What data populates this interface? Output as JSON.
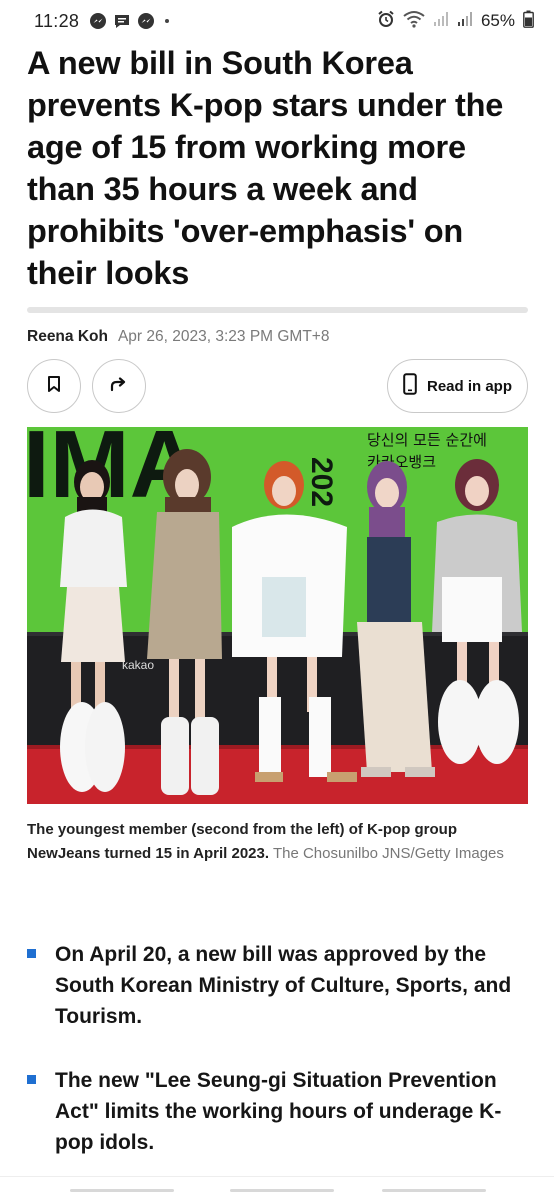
{
  "status_bar": {
    "time": "11:28",
    "battery": "65%",
    "notification_icons": [
      "messenger-icon",
      "chat-icon",
      "messenger-icon"
    ],
    "system_icons": [
      "alarm-icon",
      "wifi-icon",
      "signal-icon",
      "signal-icon",
      "battery-icon"
    ]
  },
  "article": {
    "headline": "A new bill in South Korea prevents K-pop stars under the age of 15 from working more than 35 hours a week and prohibits 'over-emphasis' on their looks",
    "author": "Reena Koh",
    "date": "Apr 26, 2023, 3:23 PM GMT+8",
    "read_in_app_label": "Read in app",
    "photo": {
      "sign_letters_left": "IMA",
      "sign_vertical": "202",
      "sign_korean_line1": "당신의 모든 순간에",
      "sign_korean_line2": "카카오뱅크",
      "sponsor_text": "kakao"
    },
    "caption": {
      "text": "The youngest member (second from the left) of K-pop group NewJeans turned 15 in April 2023.",
      "credit": "The Chosunilbo JNS/Getty Images"
    },
    "bullets": [
      "On April 20, a new bill was approved by the South Korean Ministry of Culture, Sports, and Tourism.",
      "The new \"Lee Seung-gi Situation Prevention Act\" limits the working hours of underage K-pop idols."
    ]
  },
  "colors": {
    "bullet_accent": "#1f6fd1",
    "backdrop_green": "#5cc63a",
    "carpet_red": "#c8232c"
  }
}
